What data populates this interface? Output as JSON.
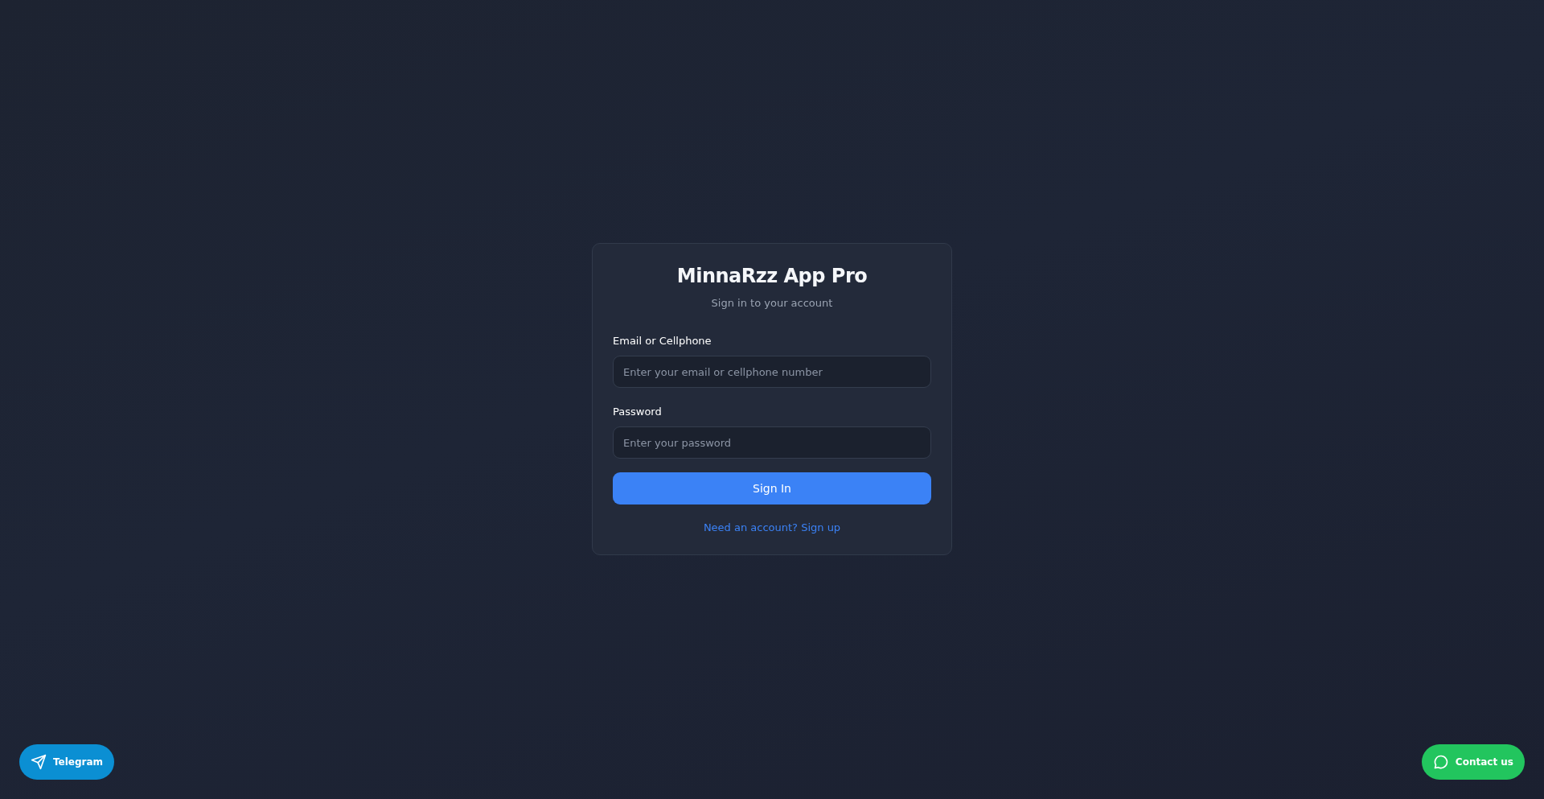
{
  "card": {
    "title": "MinnaRzz App Pro",
    "subtitle": "Sign in to your account",
    "fields": [
      {
        "label": "Email or Cellphone",
        "placeholder": "Enter your email or cellphone number"
      },
      {
        "label": "Password",
        "placeholder": "Enter your password"
      }
    ],
    "submit": "Sign In",
    "signup_link": "Need an account? Sign up"
  },
  "floating_buttons": [
    {
      "label": "Telegram",
      "kind": "telegram",
      "color": "#0b8fd3"
    },
    {
      "label": "Contact us",
      "kind": "chat",
      "color": "#22c55e"
    }
  ]
}
